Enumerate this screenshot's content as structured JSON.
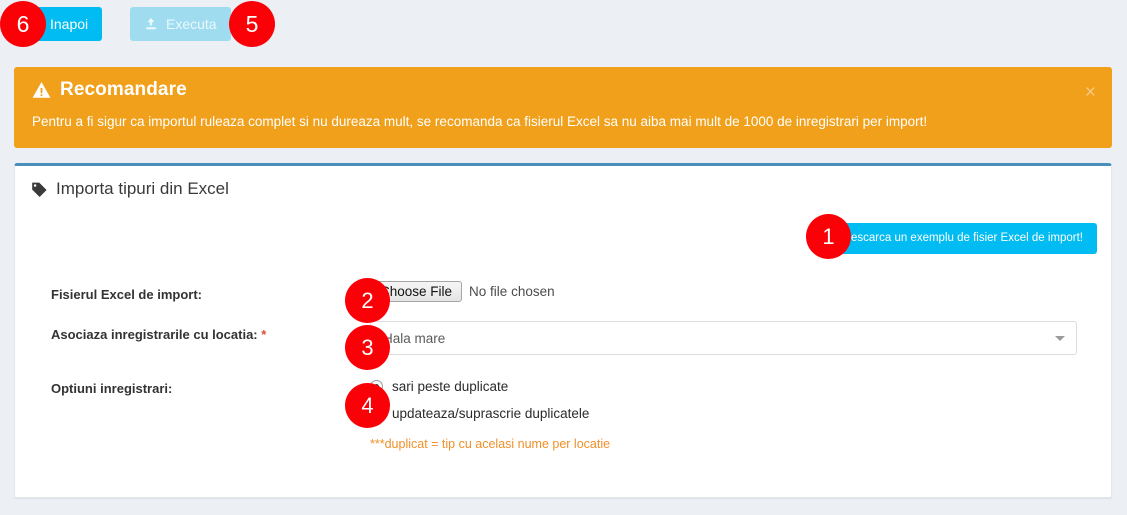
{
  "toolbar": {
    "back_label": "Inapoi",
    "execute_label": "Executa",
    "back_icon": "arrow-left-icon",
    "execute_icon": "upload-icon"
  },
  "alert": {
    "title": "Recomandare",
    "icon": "warning-triangle-icon",
    "body": "Pentru a fi sigur ca importul ruleaza complet si nu dureaza mult, se recomanda ca fisierul Excel sa nu aiba mai mult de 1000 de inregistrari per import!",
    "close_label": "×",
    "background_color": "#f0a01a"
  },
  "panel": {
    "title": "Importa tipuri din Excel",
    "title_icon": "tag-icon",
    "accent_color": "#4a8fbb",
    "download_sample_label": "Descarca un exemplu de fisier Excel de import!",
    "download_sample_color": "#00bcf2"
  },
  "form": {
    "file_row": {
      "label": "Fisierul Excel de import:",
      "choose_button_label": "Choose File",
      "file_status": "No file chosen"
    },
    "location_row": {
      "label": "Asociaza inregistrarile cu locatia:",
      "required_marker": "*",
      "selected_value": "Hala mare",
      "caret_icon": "chevron-down-icon"
    },
    "options_row": {
      "label": "Optiuni inregistrari:",
      "radios": [
        {
          "label": "sari peste duplicate",
          "checked": true
        },
        {
          "label": "updateaza/suprascrie duplicatele",
          "checked": false
        }
      ],
      "help_text": "***duplicat = tip cu acelasi nume per locatie",
      "help_color": "#f0902a"
    }
  },
  "annotations": {
    "badge_color": "#fa0007",
    "items": [
      {
        "number": "1"
      },
      {
        "number": "2"
      },
      {
        "number": "3"
      },
      {
        "number": "4"
      },
      {
        "number": "5"
      },
      {
        "number": "6"
      }
    ]
  }
}
